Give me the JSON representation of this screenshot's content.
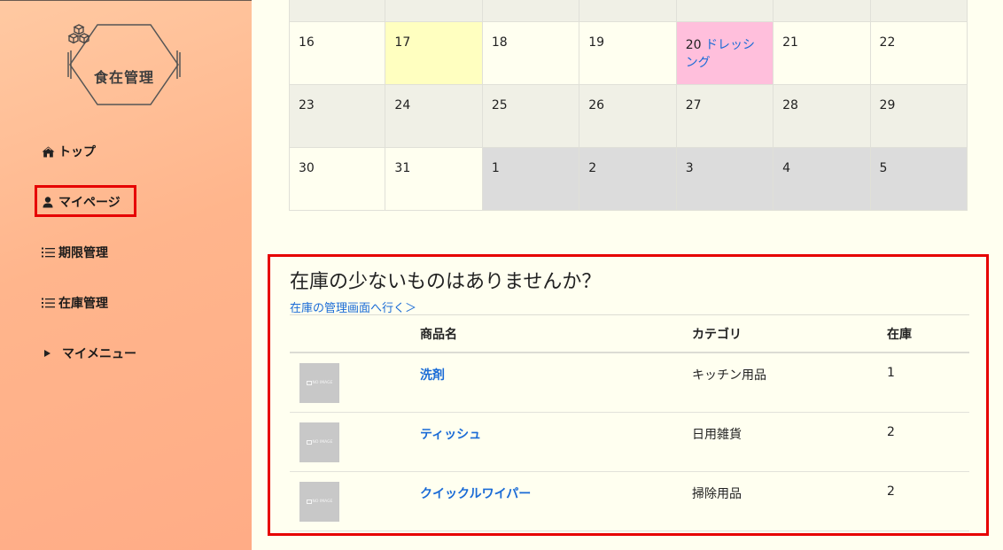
{
  "sidebar": {
    "logo_text": "食在管理",
    "items": [
      {
        "label": "トップ",
        "icon": "home-icon"
      },
      {
        "label": "マイページ",
        "icon": "user-icon"
      },
      {
        "label": "期限管理",
        "icon": "list-icon"
      },
      {
        "label": "在庫管理",
        "icon": "list-icon"
      },
      {
        "label": "マイメニュー",
        "icon": "triangle-right-icon"
      }
    ]
  },
  "calendar": {
    "rows": [
      [
        "",
        "",
        "",
        "",
        "",
        "",
        ""
      ],
      [
        "16",
        "17",
        "18",
        "19",
        "20",
        "21",
        "22"
      ],
      [
        "23",
        "24",
        "25",
        "26",
        "27",
        "28",
        "29"
      ],
      [
        "30",
        "31",
        "1",
        "2",
        "3",
        "4",
        "5"
      ]
    ],
    "event": {
      "day": "20",
      "label": "ドレッシング"
    }
  },
  "stock": {
    "title": "在庫の少ないものはありませんか？",
    "link": "在庫の管理画面へ行く＞",
    "headers": {
      "name": "商品名",
      "category": "カテゴリ",
      "qty": "在庫"
    },
    "no_image": "NO IMAGE",
    "items": [
      {
        "name": "洗剤",
        "category": "キッチン用品",
        "qty": "1"
      },
      {
        "name": "ティッシュ",
        "category": "日用雑貨",
        "qty": "2"
      },
      {
        "name": "クイックルワイパー",
        "category": "掃除用品",
        "qty": "2"
      }
    ]
  },
  "colors": {
    "accent": "#1a6bd6",
    "highlight": "#e60000",
    "sidebar": "#ffb58c"
  }
}
